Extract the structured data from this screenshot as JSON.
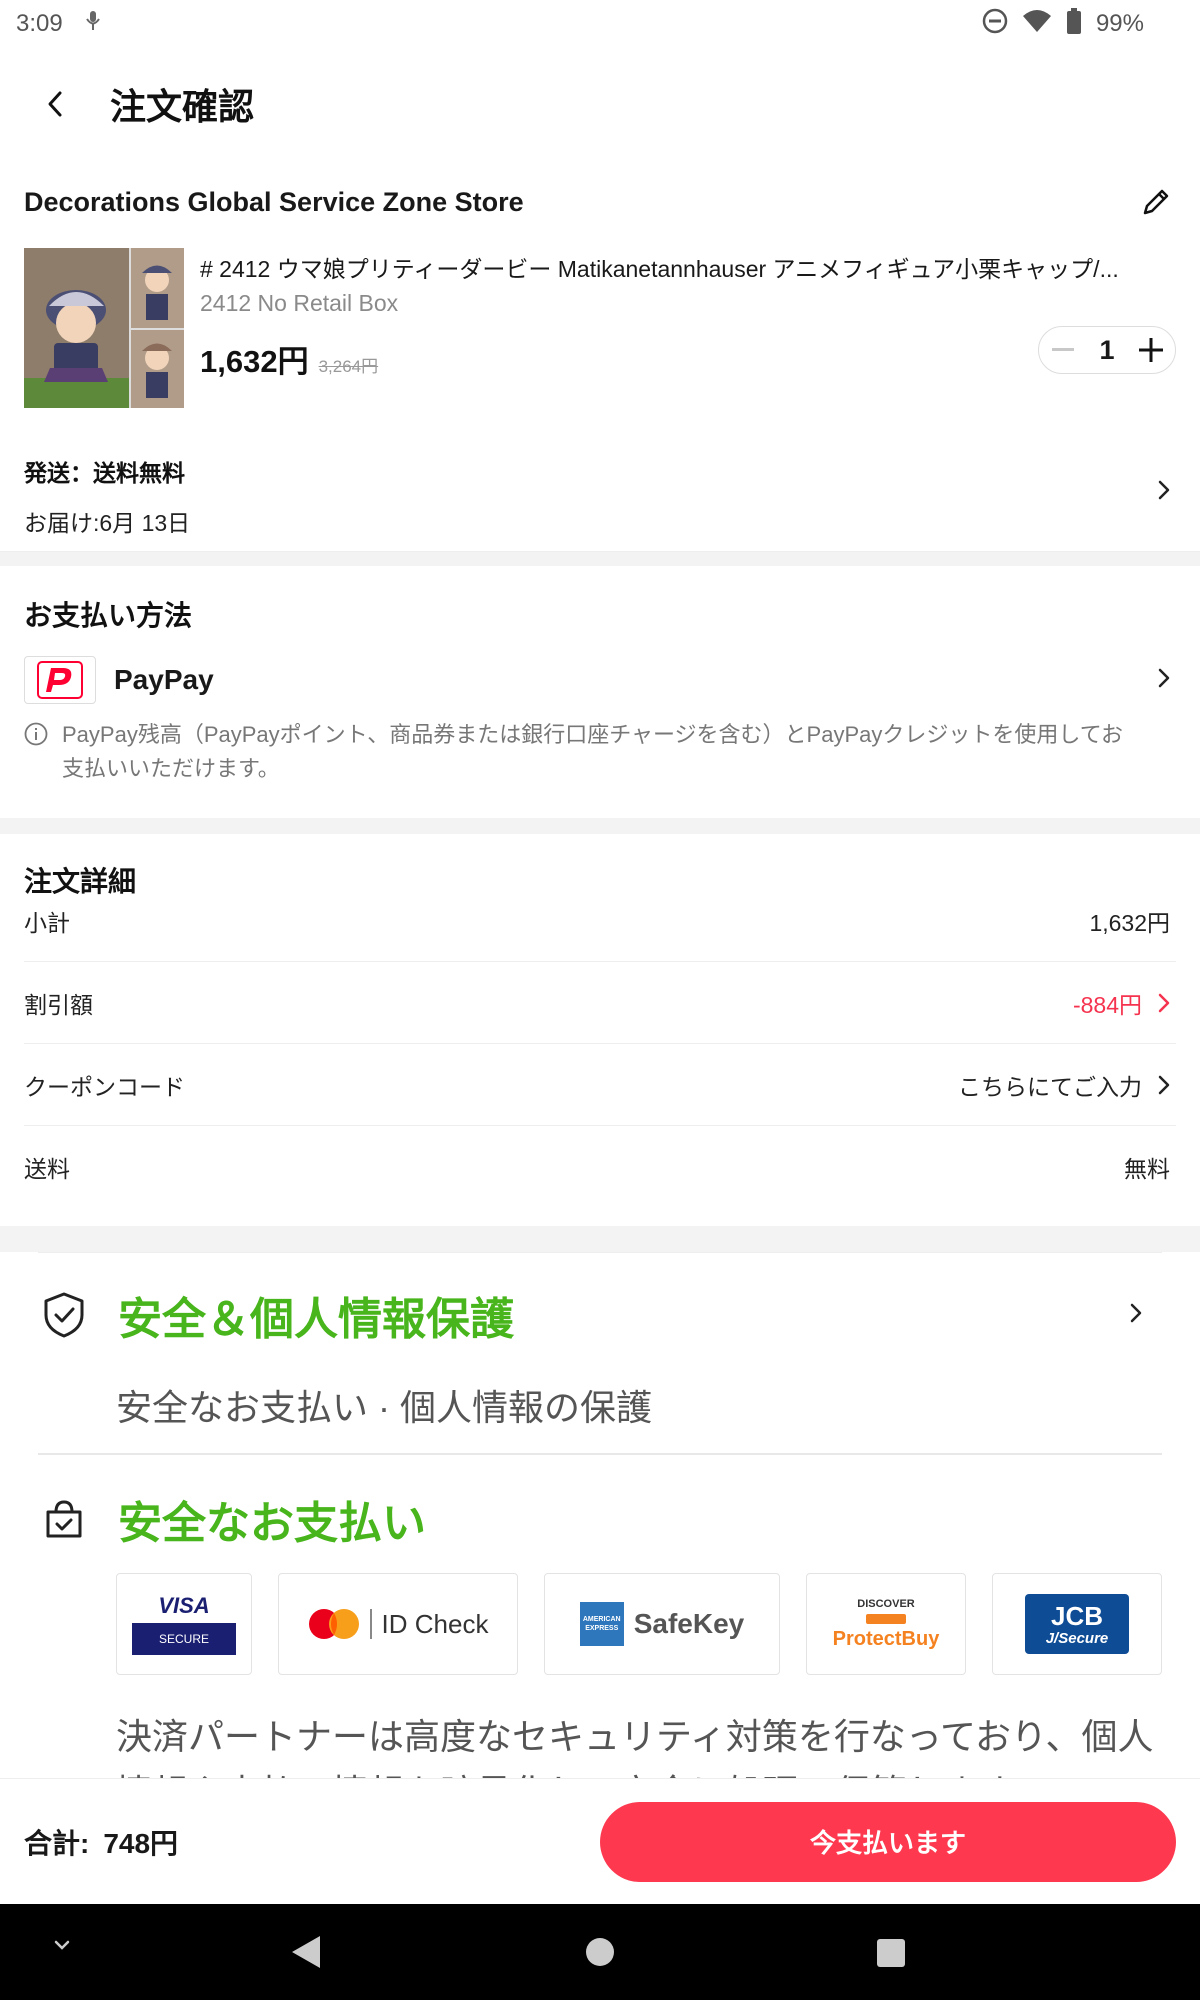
{
  "status_bar": {
    "time": "3:09",
    "battery": "99%"
  },
  "header": {
    "title": "注文確認"
  },
  "store": {
    "name": "Decorations Global Service Zone Store",
    "product": {
      "title": "# 2412 ウマ娘プリティーダービー Matikanetannhauser アニメフィギュア小栗キャップ/...",
      "variant": "2412 No Retail Box",
      "price": "1,632円",
      "original_price": "3,264円",
      "quantity": "1"
    },
    "shipping": {
      "line1": "発送：送料無料",
      "line2": "お届け:6月 13日"
    }
  },
  "payment": {
    "title": "お支払い方法",
    "method": "PayPay",
    "note": "PayPay残高（PayPayポイント、商品券または銀行口座チャージを含む）とPayPayクレジットを使用してお支払いいただけます。"
  },
  "details": {
    "title": "注文詳細",
    "rows": [
      {
        "label": "小計",
        "value": "1,632円"
      },
      {
        "label": "割引額",
        "value": "-884円"
      },
      {
        "label": "クーポンコード",
        "value": "こちらにてご入力"
      },
      {
        "label": "送料",
        "value": "無料"
      }
    ]
  },
  "security": {
    "title": "安全＆個人情報保護",
    "subtitle": "安全なお支払い · 個人情報の保護",
    "payment_title": "安全なお支払い",
    "badges": [
      "VISA",
      "SECURE",
      "ID Check",
      "SafeKey",
      "DISCOVER",
      "ProtectBuy",
      "JCB",
      "J/Secure",
      "AMERICAN EXPRESS"
    ],
    "description": "決済パートナーは高度なセキュリティ対策を行なっており、個人情報や支払い情報を暗号化して安全に処理・保管します"
  },
  "footer": {
    "total_label": "合計:",
    "total_value": "748円",
    "pay_label": "今支払います"
  },
  "colors": {
    "accent": "#fd384f",
    "green": "#47b51b",
    "discount": "#f5334f"
  }
}
